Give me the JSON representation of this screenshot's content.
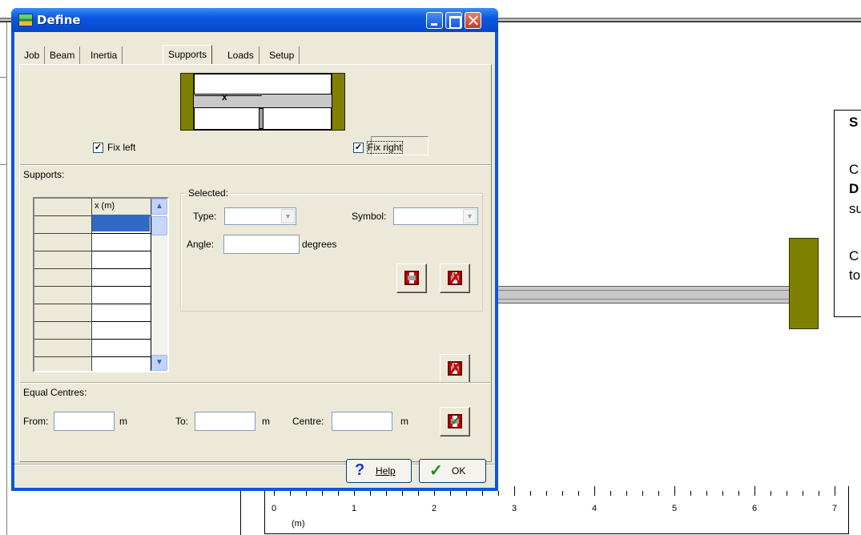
{
  "window": {
    "title": "Define"
  },
  "tabs": [
    "Job",
    "Beam",
    "Inertia",
    "Supports",
    "Loads",
    "Setup"
  ],
  "active_tab": "Supports",
  "figure": {
    "dim_label": "x"
  },
  "fix_left": {
    "label": "Fix left",
    "checked": true
  },
  "fix_right": {
    "label": "Fix right",
    "checked": true
  },
  "supports_group": {
    "label": "Supports:",
    "column_header": "x (m)",
    "rows": [
      "",
      "",
      "",
      "",
      "",
      "",
      "",
      "",
      ""
    ]
  },
  "selected_group": {
    "label": "Selected:",
    "type_label": "Type:",
    "type_value": "",
    "symbol_label": "Symbol:",
    "symbol_value": "",
    "angle_label": "Angle:",
    "angle_value": "",
    "angle_unit": "degrees"
  },
  "equal_centres": {
    "label": "Equal Centres:",
    "from_label": "From:",
    "from_value": "",
    "to_label": "To:",
    "to_value": "",
    "centre_label": "Centre:",
    "centre_value": "",
    "unit": "m"
  },
  "buttons": {
    "help": "Help",
    "ok": "OK"
  },
  "background": {
    "info_lines": [
      "S",
      "C",
      "D",
      "su",
      "C",
      "to"
    ],
    "ruler_ticks": [
      "0",
      "1",
      "2",
      "3",
      "4",
      "5",
      "6",
      "7"
    ],
    "ruler_unit": "(m)"
  },
  "colors": {
    "title_bar": "#0b58e2",
    "dialog_face": "#ece9d8",
    "support_fill": "#808000",
    "grid_selection": "#316ac5"
  }
}
